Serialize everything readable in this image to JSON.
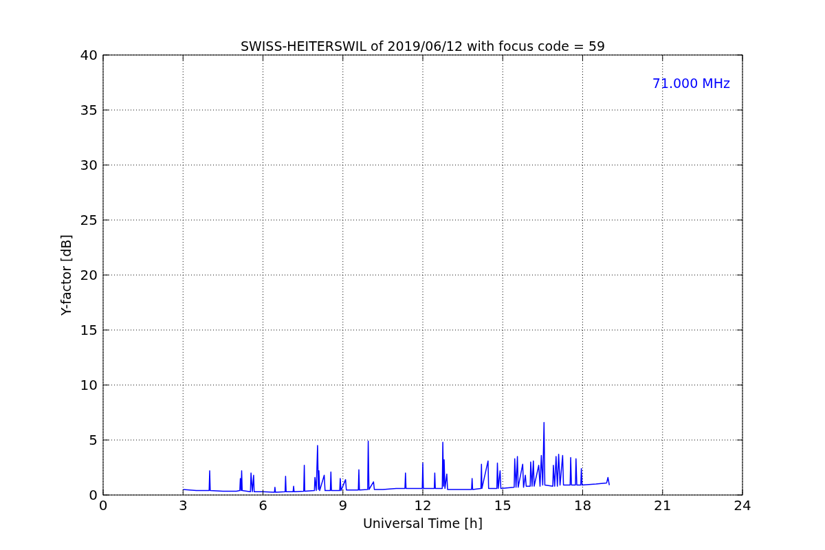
{
  "chart_data": {
    "type": "line",
    "title": "SWISS-HEITERSWIL of 2019/06/12 with focus code = 59",
    "xlabel": "Universal Time [h]",
    "ylabel": "Y-factor [dB]",
    "grid": true,
    "xlim": [
      0,
      24
    ],
    "ylim": [
      0,
      40
    ],
    "xticks": [
      0,
      3,
      6,
      9,
      12,
      15,
      18,
      21,
      24
    ],
    "yticks": [
      0,
      5,
      10,
      15,
      20,
      25,
      30,
      35,
      40
    ],
    "x": [
      3.0,
      3.5,
      3.98,
      4.0,
      4.02,
      4.5,
      5.0,
      5.13,
      5.15,
      5.18,
      5.2,
      5.22,
      5.53,
      5.55,
      5.6,
      5.65,
      5.67,
      6.0,
      6.43,
      6.45,
      6.47,
      6.83,
      6.85,
      6.87,
      7.13,
      7.15,
      7.17,
      7.53,
      7.55,
      7.57,
      7.93,
      7.95,
      8.0,
      8.05,
      8.08,
      8.1,
      8.13,
      8.3,
      8.33,
      8.53,
      8.55,
      8.57,
      8.88,
      8.9,
      8.93,
      9.1,
      9.13,
      9.58,
      9.6,
      9.62,
      9.93,
      9.95,
      9.98,
      10.15,
      10.18,
      10.5,
      11.0,
      11.33,
      11.35,
      11.37,
      11.98,
      12.0,
      12.02,
      12.43,
      12.45,
      12.47,
      12.73,
      12.75,
      12.78,
      12.8,
      12.83,
      12.9,
      12.93,
      13.5,
      13.83,
      13.85,
      13.87,
      14.18,
      14.2,
      14.22,
      14.45,
      14.47,
      14.78,
      14.8,
      14.83,
      14.9,
      14.93,
      15.43,
      15.45,
      15.5,
      15.55,
      15.58,
      15.75,
      15.78,
      15.85,
      15.88,
      16.03,
      16.05,
      16.1,
      16.15,
      16.18,
      16.35,
      16.4,
      16.45,
      16.5,
      16.55,
      16.58,
      16.88,
      16.9,
      16.95,
      17.0,
      17.05,
      17.1,
      17.15,
      17.25,
      17.28,
      17.53,
      17.55,
      17.58,
      17.73,
      17.75,
      17.78,
      17.93,
      17.95,
      17.98,
      18.5,
      18.9,
      18.95,
      19.0
    ],
    "series": [
      {
        "name": "71.000 MHz",
        "color": "#0000ff",
        "values": [
          0.5,
          0.4,
          0.4,
          2.2,
          0.4,
          0.35,
          0.35,
          0.4,
          1.5,
          0.4,
          2.2,
          0.4,
          0.3,
          2.0,
          0.3,
          1.8,
          0.3,
          0.3,
          0.25,
          0.7,
          0.25,
          0.3,
          1.7,
          0.3,
          0.3,
          0.8,
          0.3,
          0.35,
          2.7,
          0.35,
          0.4,
          1.6,
          0.4,
          4.5,
          0.5,
          2.2,
          0.4,
          1.8,
          0.4,
          0.4,
          2.1,
          0.4,
          0.4,
          1.5,
          0.4,
          1.4,
          0.45,
          0.45,
          2.3,
          0.45,
          0.5,
          4.9,
          0.5,
          1.2,
          0.5,
          0.5,
          0.6,
          0.6,
          2.0,
          0.6,
          0.6,
          2.9,
          0.6,
          0.6,
          2.0,
          0.6,
          0.6,
          4.8,
          0.8,
          3.2,
          0.6,
          1.9,
          0.5,
          0.5,
          0.5,
          1.5,
          0.5,
          0.6,
          2.8,
          0.6,
          3.1,
          0.6,
          0.6,
          2.9,
          0.6,
          2.2,
          0.6,
          0.7,
          3.3,
          0.7,
          3.5,
          0.7,
          2.8,
          0.7,
          1.8,
          0.8,
          0.8,
          3.0,
          0.8,
          3.1,
          0.8,
          2.7,
          0.8,
          3.6,
          0.9,
          6.6,
          0.9,
          0.8,
          2.7,
          0.8,
          3.5,
          0.8,
          3.7,
          0.9,
          3.6,
          0.9,
          0.9,
          3.4,
          0.9,
          0.9,
          3.3,
          0.9,
          0.9,
          2.4,
          0.9,
          1.0,
          1.1,
          1.6,
          0.9
        ]
      }
    ]
  }
}
